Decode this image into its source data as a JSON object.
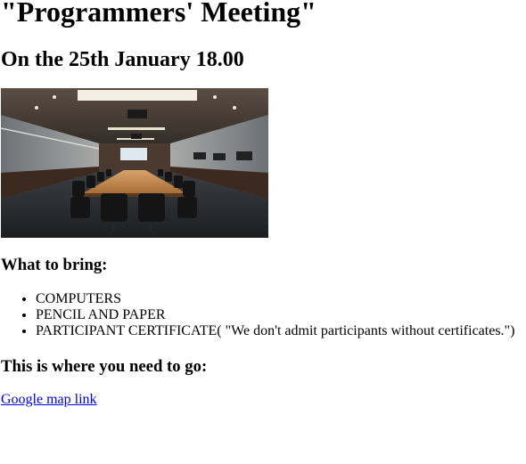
{
  "page": {
    "title": "\"Programmers' Meeting\"",
    "subtitle": "On the 25th January 18.00"
  },
  "photo": {
    "subject": "conference-room"
  },
  "bring": {
    "heading": "What to bring:",
    "items": [
      "COMPUTERS",
      "PENCIL AND PAPER",
      "PARTICIPANT CERTIFICATE( \"We don't admit participants without certificates.\")"
    ]
  },
  "directions": {
    "heading": "This is where you need to go:",
    "link_label": "Google map link"
  },
  "colors": {
    "link": "#0000ee",
    "text": "#000000",
    "background": "#ffffff"
  }
}
